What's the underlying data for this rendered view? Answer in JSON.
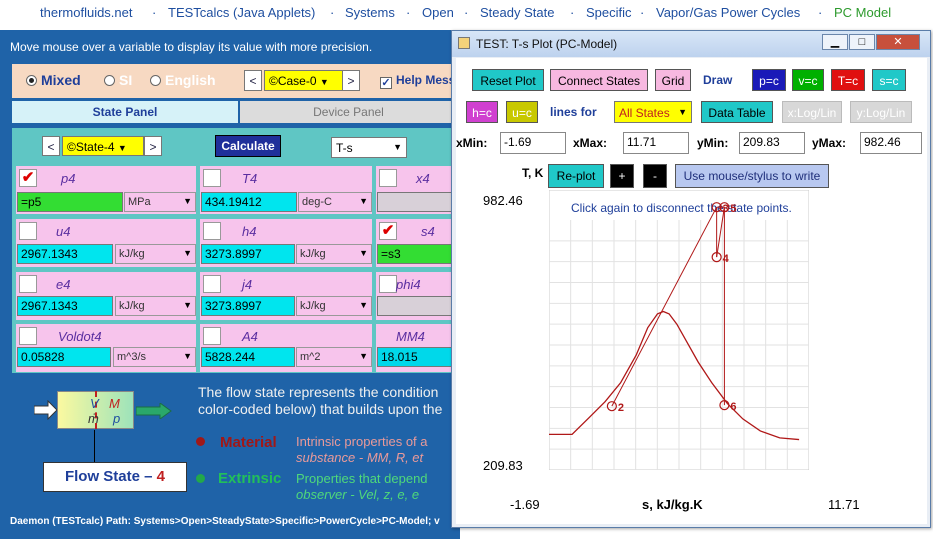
{
  "nav": {
    "links": [
      "thermofluids.net",
      "TESTcalcs (Java Applets)",
      "Systems",
      "Open",
      "Steady State",
      "Specific",
      "Vapor/Gas Power Cycles",
      "PC Model"
    ],
    "separator": "·"
  },
  "main": {
    "message": "Move mouse over a variable to display its value with more precision.",
    "units": {
      "mixed": "Mixed",
      "si": "SI",
      "english": "English",
      "selected": "Mixed"
    },
    "case": {
      "prev": "<",
      "value": "©Case-0",
      "next": ">",
      "arrow": "▼"
    },
    "help": "Help Mess",
    "tabs": {
      "state": "State Panel",
      "device": "Device Panel"
    },
    "state": {
      "prev": "<",
      "value": "©State-4",
      "next": ">",
      "arrow": "▼"
    },
    "calculate": "Calculate",
    "diagram_select": "T-s",
    "cells": [
      {
        "label": "p4",
        "checked": true,
        "value": "=p5",
        "unit": "MPa"
      },
      {
        "label": "T4",
        "checked": false,
        "value": "434.19412",
        "unit": "deg-C"
      },
      {
        "label": "x4",
        "checked": false,
        "value": "",
        "unit": ""
      },
      {
        "label": "u4",
        "checked": false,
        "value": "2967.1343",
        "unit": "kJ/kg"
      },
      {
        "label": "h4",
        "checked": false,
        "value": "3273.8997",
        "unit": "kJ/kg"
      },
      {
        "label": "s4",
        "checked": true,
        "value": "=s3",
        "unit": ""
      },
      {
        "label": "e4",
        "checked": false,
        "value": "2967.1343",
        "unit": "kJ/kg"
      },
      {
        "label": "j4",
        "checked": false,
        "value": "3273.8997",
        "unit": "kJ/kg"
      },
      {
        "label": "phi4",
        "checked": false,
        "value": "",
        "unit": ""
      },
      {
        "label": "Voldot4",
        "checked": false,
        "value": "0.05828",
        "unit": "m^3/s"
      },
      {
        "label": "A4",
        "checked": false,
        "value": "5828.244",
        "unit": "m^2"
      },
      {
        "label": "MM4",
        "checked": false,
        "value": "18.015",
        "unit": ""
      }
    ],
    "flow": {
      "text_line1": "The flow state represents the condition",
      "text_line2": "color-coded below) that builds upon the",
      "material_title": "Material",
      "material_line1": "Intrinsic properties of a",
      "material_line2": "substance -  MM, R, et",
      "extrinsic_title": "Extrinsic",
      "extrinsic_line1": "Properties that depend",
      "extrinsic_line2": "observer -  Vel, z, e, e",
      "state_label": "Flow State",
      "state_dash": "–",
      "state_number": "4",
      "diagram_V": "V",
      "diagram_M": "M",
      "diagram_m": "ṁ",
      "diagram_p": "p"
    },
    "path": "Daemon (TESTcalc) Path:  Systems>Open>SteadyState>Specific>PowerCycle>PC-Model; v"
  },
  "popup": {
    "title": "TEST: T-s Plot (PC-Model)",
    "window_buttons": [
      "▁",
      "□",
      "✕"
    ],
    "buttons": {
      "reset_plot": "Reset Plot",
      "connect_states": "Connect States",
      "grid": "Grid",
      "draw": "Draw",
      "p_c": "p=c",
      "v_c": "v=c",
      "T_c": "T=c",
      "s_c": "s=c",
      "h_c": "h=c",
      "u_c": "u=c",
      "lines_for": "lines for",
      "all_states": "All States",
      "data_table": "Data Table",
      "x_log": "x:Log/Lin",
      "y_log": "y:Log/Lin",
      "replot": "Re-plot",
      "plus": "+",
      "minus": "-",
      "mouse_write": "Use mouse/stylus to write"
    },
    "fields": {
      "xmin_label": "xMin:",
      "xmin": "-1.69",
      "xmax_label": "xMax:",
      "xmax": "11.71",
      "ymin_label": "yMin:",
      "ymin": "209.83",
      "ymax_label": "yMax:",
      "ymax": "982.46"
    },
    "colors": {
      "p_c": "#1a1ab8",
      "v_c": "#00b000",
      "T_c": "#e01010",
      "s_c": "#20c8c8",
      "h_c": "#d040d0",
      "u_c": "#c8c800",
      "curve": "#b01818"
    }
  },
  "chart_data": {
    "type": "line",
    "title": "",
    "ylabel": "T, K",
    "xlabel": "s, kJ/kg.K",
    "xlim": [
      -1.69,
      11.71
    ],
    "ylim": [
      209.83,
      982.46
    ],
    "x_tick_labels": [
      "-1.69",
      "11.71"
    ],
    "y_tick_labels": [
      "982.46",
      "209.83"
    ],
    "annotation": "Click again to disconnect the state points.",
    "series": [
      {
        "kind": "saturation-dome",
        "x": [
          -1.69,
          -0.5,
          0.4,
          1.2,
          2.0,
          2.8,
          3.4,
          3.9,
          4.2,
          4.5,
          4.9,
          5.4,
          6.0,
          6.7,
          7.5,
          8.3,
          9.2,
          10.2,
          11.2
        ],
        "y": [
          290,
          290,
          340,
          385,
          440,
          520,
          600,
          640,
          647,
          640,
          610,
          560,
          500,
          440,
          380,
          335,
          300,
          280,
          275
        ]
      }
    ],
    "states": [
      {
        "label": "2",
        "x": 1.55,
        "y": 372
      },
      {
        "label": "3",
        "x": 6.95,
        "y": 950
      },
      {
        "label": "4",
        "x": 6.95,
        "y": 805
      },
      {
        "label": "5",
        "x": 7.35,
        "y": 950
      },
      {
        "label": "6",
        "x": 7.35,
        "y": 375
      }
    ]
  }
}
